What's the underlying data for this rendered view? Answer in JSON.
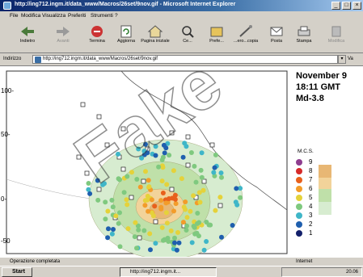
{
  "window": {
    "title": "http://ing712.ingm.it/data_www/Macros/26set/9nov.gif - Microsoft Internet Explorer",
    "controls": [
      "_",
      "□",
      "×"
    ]
  },
  "menubar": {
    "items": [
      "File",
      "Modifica",
      "Visualizza",
      "Preferiti",
      "Strumenti",
      "?"
    ]
  },
  "toolbar": {
    "buttons": [
      {
        "label": "Indietro",
        "icon": "back-arrow-icon",
        "enabled": true
      },
      {
        "label": "Avanti",
        "icon": "forward-arrow-icon",
        "enabled": false
      },
      {
        "label": "Termina",
        "icon": "stop-icon",
        "enabled": true
      },
      {
        "label": "Aggiorna",
        "icon": "refresh-icon",
        "enabled": true
      },
      {
        "label": "Pagina iniziale",
        "icon": "home-icon",
        "enabled": true
      },
      {
        "label": "Ce...",
        "icon": "search-icon",
        "enabled": true
      },
      {
        "label": "Prefe...",
        "icon": "favorites-icon",
        "enabled": true
      },
      {
        "label": "...ero...copia",
        "icon": "history-icon",
        "enabled": true
      },
      {
        "label": "Posta",
        "icon": "mail-icon",
        "enabled": true
      },
      {
        "label": "Stampa",
        "icon": "print-icon",
        "enabled": true
      },
      {
        "label": "Modifica",
        "icon": "edit-icon",
        "enabled": false
      }
    ]
  },
  "address": {
    "label": "Indirizzo",
    "value": "http://ing712.ingm.it/data_www/Macros/26set/9nov.gif",
    "go_label": "Va"
  },
  "map": {
    "date": "November 9",
    "time": "18:11 GMT",
    "magnitude": "Md-3.8",
    "y_ticks": [
      "100-",
      "50-",
      "0-",
      "-50"
    ],
    "legend_title": "M.C.S.",
    "legend": [
      {
        "level": "9",
        "color": "#8e3d8f"
      },
      {
        "level": "8",
        "color": "#d62a2a"
      },
      {
        "level": "7",
        "color": "#e8601c"
      },
      {
        "level": "6",
        "color": "#f39c2a"
      },
      {
        "level": "5",
        "color": "#e5d23a"
      },
      {
        "level": "4",
        "color": "#7fc97f"
      },
      {
        "level": "3",
        "color": "#3fb6c8"
      },
      {
        "level": "2",
        "color": "#1f5fae"
      },
      {
        "level": "1",
        "color": "#13206b"
      }
    ],
    "contour_colors": [
      "#d7ecd0",
      "#bfe0a9",
      "#f2d39a",
      "#e8b774"
    ]
  },
  "status": {
    "text": "Operazione completata",
    "zone": "Internet"
  },
  "taskbar": {
    "start_label": "Start",
    "task_label": "http://ing712.ingm.it...",
    "clock": "20.06"
  },
  "watermark": {
    "text": "Fake"
  }
}
